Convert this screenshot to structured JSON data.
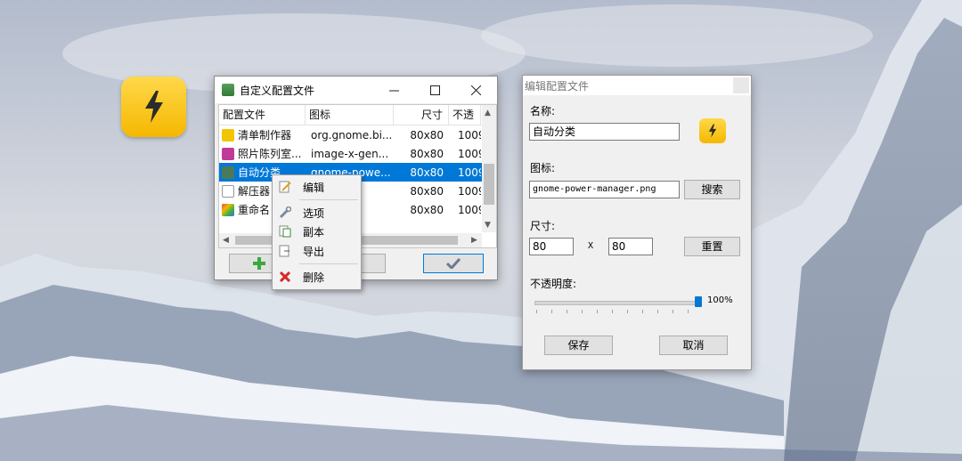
{
  "desktop": {
    "app_icon": "lightning-icon"
  },
  "profiles_window": {
    "title": "自定义配置文件",
    "columns": [
      "配置文件",
      "图标",
      "尺寸",
      "不透"
    ],
    "rows": [
      {
        "name": "清单制作器",
        "icon": "org.gnome.bi...",
        "size": "80x80",
        "opacity": "1009",
        "color": "#f2c500"
      },
      {
        "name": "照片陈列室...",
        "icon": "image-x-gen...",
        "size": "80x80",
        "opacity": "1009",
        "color": "#c03a9a"
      },
      {
        "name": "自动分类",
        "icon": "gnome-powe...",
        "size": "80x80",
        "opacity": "1009",
        "color": "#f5b800",
        "selected": true
      },
      {
        "name": "解压器",
        "icon": "...ler-...",
        "size": "80x80",
        "opacity": "1009",
        "color": "#d0d0d0"
      },
      {
        "name": "重命名",
        "icon": "...olor...",
        "size": "80x80",
        "opacity": "1009",
        "color": "#e54b3c"
      }
    ]
  },
  "context_menu": {
    "items": [
      "编辑",
      "选项",
      "副本",
      "导出",
      "删除"
    ]
  },
  "edit_dialog": {
    "title": "编辑配置文件",
    "name_label": "名称:",
    "name_value": "自动分类",
    "icon_label": "图标:",
    "icon_value": "gnome-power-manager.png",
    "search_label": "搜索",
    "size_label": "尺寸:",
    "width": "80",
    "x_label": "X",
    "height": "80",
    "reset_label": "重置",
    "opacity_label": "不透明度:",
    "opacity_value": "100%",
    "opacity_level": 1.0,
    "save_label": "保存",
    "cancel_label": "取消"
  },
  "colors": {
    "accent": "#0078d7",
    "icon_yellow": "#f5b800"
  }
}
